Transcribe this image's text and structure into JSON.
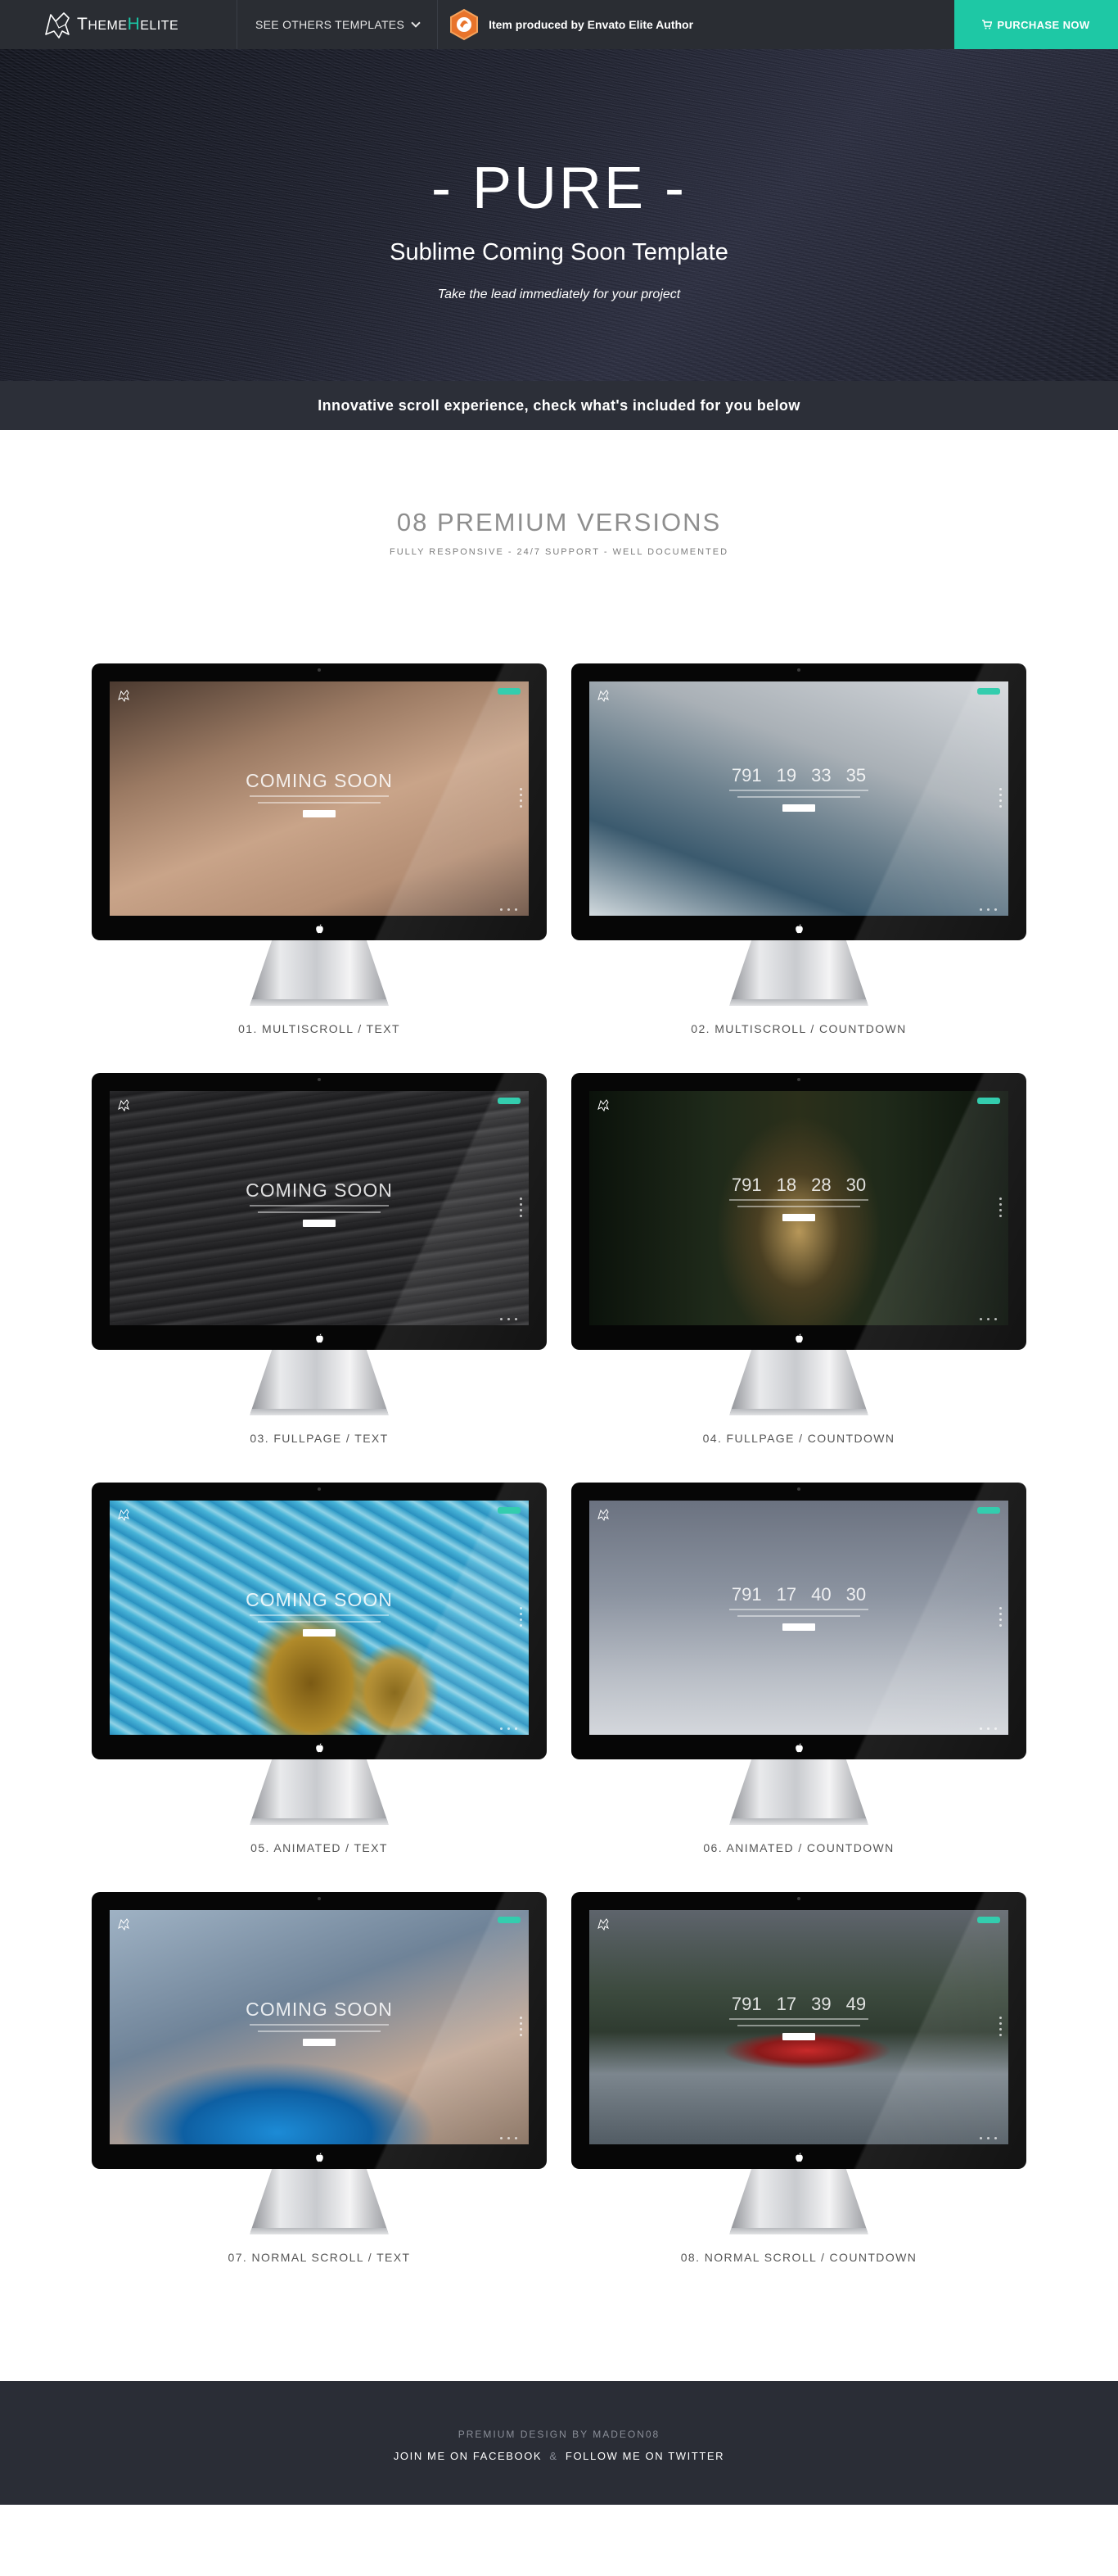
{
  "topbar": {
    "logo_first": "T",
    "logo_a": "HEME",
    "logo_mid": "H",
    "logo_b": "ELITE",
    "templates_label": "SEE OTHERS TEMPLATES",
    "envato_text": "Item produced by Envato Elite Author",
    "purchase_label": "PURCHASE NOW",
    "accent_color": "#1ec8a5"
  },
  "hero": {
    "title": "- PURE -",
    "subtitle": "Sublime Coming Soon Template",
    "tagline": "Take the lead immediately for your project",
    "strip_text": "Innovative scroll experience, check what's included for you below"
  },
  "section": {
    "title": "08 PREMIUM VERSIONS",
    "subtitle": "FULLY RESPONSIVE - 24/7 SUPPORT - WELL DOCUMENTED"
  },
  "versions": [
    {
      "label": "01. MULTISCROLL / TEXT",
      "scene": "desert",
      "kind": "text",
      "coming": "COMING SOON"
    },
    {
      "label": "02. MULTISCROLL / COUNTDOWN",
      "scene": "falls",
      "kind": "countdown",
      "count": [
        "791",
        "19",
        "33",
        "35"
      ]
    },
    {
      "label": "03. FULLPAGE / TEXT",
      "scene": "sea",
      "kind": "text",
      "coming": "COMING SOON"
    },
    {
      "label": "04. FULLPAGE / COUNTDOWN",
      "scene": "forest",
      "kind": "countdown",
      "count": [
        "791",
        "18",
        "28",
        "30"
      ]
    },
    {
      "label": "05. ANIMATED / TEXT",
      "scene": "pool",
      "kind": "text",
      "coming": "COMING SOON"
    },
    {
      "label": "06. ANIMATED / COUNTDOWN",
      "scene": "sky",
      "kind": "countdown",
      "count": [
        "791",
        "17",
        "40",
        "30"
      ]
    },
    {
      "label": "07. NORMAL SCROLL / TEXT",
      "scene": "watch",
      "kind": "text",
      "coming": "COMING SOON"
    },
    {
      "label": "08. NORMAL SCROLL / COUNTDOWN",
      "scene": "lake",
      "kind": "countdown",
      "count": [
        "791",
        "17",
        "39",
        "49"
      ]
    }
  ],
  "footer": {
    "credit": "PREMIUM DESIGN BY MADEON08",
    "facebook": "JOIN ME ON FACEBOOK",
    "amp": "&",
    "twitter": "FOLLOW ME ON TWITTER"
  },
  "icons": {
    "logo": "wolf-head-icon",
    "chevron": "chevron-down-icon",
    "envato": "envato-elite-badge-icon",
    "cart": "cart-icon",
    "apple": "apple-logo-icon"
  }
}
